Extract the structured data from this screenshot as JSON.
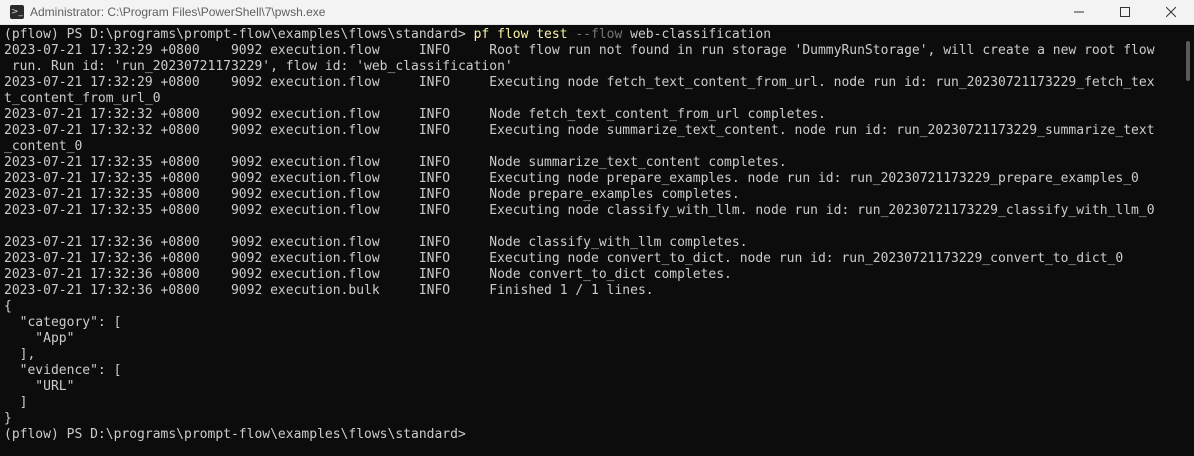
{
  "window": {
    "title": "Administrator: C:\\Program Files\\PowerShell\\7\\pwsh.exe",
    "icon": "terminal-icon",
    "controls": {
      "minimize": "minimize-icon",
      "maximize": "maximize-icon",
      "close": "close-icon"
    }
  },
  "prompt_top": {
    "prefix": "(pflow) PS D:\\programs\\prompt-flow\\examples\\flows\\standard> ",
    "command": "pf flow test ",
    "flag": "--flow",
    "arg": " web-classification"
  },
  "log_lines": [
    "2023-07-21 17:32:29 +0800    9092 execution.flow     INFO     Root flow run not found in run storage 'DummyRunStorage', will create a new root flow",
    " run. Run id: 'run_20230721173229', flow id: 'web_classification'",
    "2023-07-21 17:32:29 +0800    9092 execution.flow     INFO     Executing node fetch_text_content_from_url. node run id: run_20230721173229_fetch_tex",
    "t_content_from_url_0",
    "2023-07-21 17:32:32 +0800    9092 execution.flow     INFO     Node fetch_text_content_from_url completes.",
    "2023-07-21 17:32:32 +0800    9092 execution.flow     INFO     Executing node summarize_text_content. node run id: run_20230721173229_summarize_text",
    "_content_0",
    "2023-07-21 17:32:35 +0800    9092 execution.flow     INFO     Node summarize_text_content completes.",
    "2023-07-21 17:32:35 +0800    9092 execution.flow     INFO     Executing node prepare_examples. node run id: run_20230721173229_prepare_examples_0",
    "2023-07-21 17:32:35 +0800    9092 execution.flow     INFO     Node prepare_examples completes.",
    "2023-07-21 17:32:35 +0800    9092 execution.flow     INFO     Executing node classify_with_llm. node run id: run_20230721173229_classify_with_llm_0",
    "",
    "2023-07-21 17:32:36 +0800    9092 execution.flow     INFO     Node classify_with_llm completes.",
    "2023-07-21 17:32:36 +0800    9092 execution.flow     INFO     Executing node convert_to_dict. node run id: run_20230721173229_convert_to_dict_0",
    "2023-07-21 17:32:36 +0800    9092 execution.flow     INFO     Node convert_to_dict completes.",
    "2023-07-21 17:32:36 +0800    9092 execution.bulk     INFO     Finished 1 / 1 lines.",
    "{",
    "  \"category\": [",
    "    \"App\"",
    "  ],",
    "  \"evidence\": [",
    "    \"URL\"",
    "  ]",
    "}"
  ],
  "prompt_bottom": {
    "text": "(pflow) PS D:\\programs\\prompt-flow\\examples\\flows\\standard>"
  }
}
